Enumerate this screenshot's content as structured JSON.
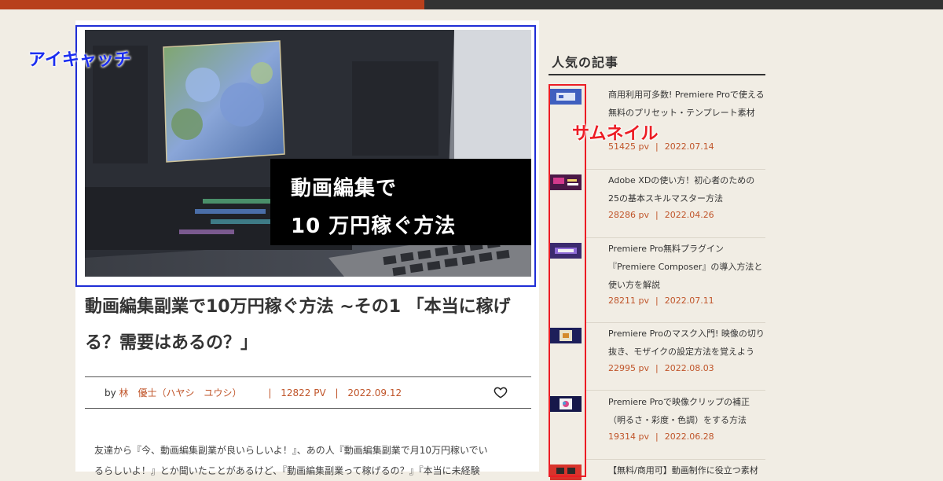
{
  "colors": {
    "accent": "#b8401c",
    "eyecatch_frame": "#1f2ed6",
    "thumb_frame": "#ec1c24"
  },
  "annotations": {
    "eyecatch_label": "アイキャッチ",
    "thumbnail_label": "サムネイル"
  },
  "hero": {
    "caption_line1": "動画編集で",
    "caption_line2": "10 万円稼ぐ方法"
  },
  "article": {
    "title": "動画編集副業で10万円稼ぐ方法 ~その1 「本当に稼げる？需要はあるの？」",
    "by": "by",
    "author": "林　優士（ハヤシ　ユウシ）",
    "views": "12822 PV",
    "date": "2022.09.12",
    "body_line1": "友達から『今、動画編集副業が良いらしいよ！』、あの人『動画編集副業で月10万円稼いでい",
    "body_line2": "るらしいよ！』とか聞いたことがあるけど、『動画編集副業って稼げるの？』『本当に未経験",
    "like_icon": "heart-icon"
  },
  "sidebar": {
    "heading": "人気の記事",
    "items": [
      {
        "title": "商用利用可多数! Premiere Proで使える無料のプリセット・テンプレート素材",
        "pv": "51425 pv",
        "date": "2022.07.14"
      },
      {
        "title": "Adobe XDの使い方！初心者のための25の基本スキルマスター方法",
        "pv": "28286 pv",
        "date": "2022.04.26"
      },
      {
        "title": "Premiere Pro無料プラグイン『Premiere Composer』の導入方法と使い方を解説",
        "pv": "28211 pv",
        "date": "2022.07.11"
      },
      {
        "title": "Premiere Proのマスク入門! 映像の切り抜き、モザイクの設定方法を覚えよう",
        "pv": "22995 pv",
        "date": "2022.08.03"
      },
      {
        "title": "Premiere Proで映像クリップの補正（明るさ・彩度・色調）をする方法",
        "pv": "19314 pv",
        "date": "2022.06.28"
      },
      {
        "title": "【無料/商用可】動画制作に役立つ素材"
      }
    ]
  }
}
